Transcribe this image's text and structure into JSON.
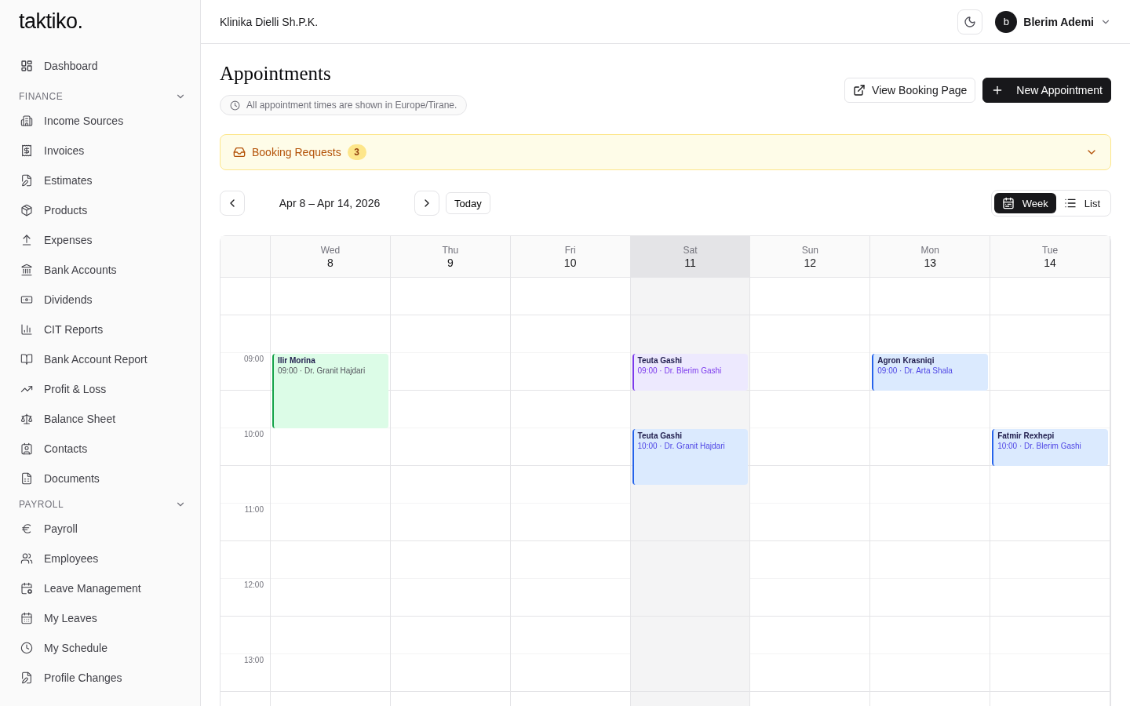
{
  "sidebar": {
    "logo": "taktiko.",
    "top_items": [
      {
        "label": "Dashboard"
      }
    ],
    "sections": [
      {
        "title": "FINANCE",
        "expanded": true,
        "items": [
          {
            "label": "Income Sources"
          },
          {
            "label": "Invoices"
          },
          {
            "label": "Estimates"
          },
          {
            "label": "Products"
          },
          {
            "label": "Expenses"
          },
          {
            "label": "Bank Accounts"
          },
          {
            "label": "Dividends"
          },
          {
            "label": "CIT Reports"
          },
          {
            "label": "Bank Account Report"
          },
          {
            "label": "Profit & Loss"
          },
          {
            "label": "Balance Sheet"
          },
          {
            "label": "Contacts"
          },
          {
            "label": "Documents"
          }
        ]
      },
      {
        "title": "PAYROLL",
        "expanded": true,
        "items": [
          {
            "label": "Payroll"
          },
          {
            "label": "Employees"
          },
          {
            "label": "Leave Management"
          },
          {
            "label": "My Leaves"
          },
          {
            "label": "My Schedule"
          },
          {
            "label": "Profile Changes"
          }
        ]
      }
    ]
  },
  "header": {
    "company": "Klinika Dielli Sh.P.K.",
    "user": {
      "initial": "b",
      "name": "Blerim Ademi"
    }
  },
  "page": {
    "title": "Appointments",
    "timezone_note": "All appointment times are shown in Europe/Tirane.",
    "buttons": [
      {
        "label": "View Booking Page",
        "kind": "secondary"
      },
      {
        "label": "New Appointment",
        "kind": "primary"
      }
    ]
  },
  "booking_requests": {
    "label": "Booking Requests",
    "count": "3",
    "expanded": false
  },
  "toolbar": {
    "range": "Apr 8 – Apr 14, 2026",
    "today": "Today",
    "views": [
      {
        "label": "Week",
        "selected": true
      },
      {
        "label": "List",
        "selected": false
      }
    ]
  },
  "calendar": {
    "hours": [
      "09:00",
      "10:00",
      "11:00",
      "12:00",
      "13:00"
    ],
    "days": [
      {
        "weekday": "Wed",
        "date": "8",
        "selected": false,
        "events": [
          {
            "name": "Ilir Morina",
            "detail": "09:00 · Dr. Granit Hajdari",
            "kind": "hour",
            "color": "#16a34a"
          }
        ]
      },
      {
        "weekday": "Thu",
        "date": "9",
        "selected": false
      },
      {
        "weekday": "Fri",
        "date": "10",
        "selected": false
      },
      {
        "weekday": "Sat",
        "date": "11",
        "selected": true,
        "events": [
          {
            "name": "Teuta Gashi",
            "detail": "09:00 · Dr. Blerim Gashi",
            "kind": "half",
            "color": "#7c3aed"
          },
          {
            "name": "Teuta Gashi",
            "detail": "10:00 · Dr. Granit Hajdari",
            "kind": "three_quarter",
            "color": "#2563eb"
          }
        ]
      },
      {
        "weekday": "Sun",
        "date": "12",
        "selected": false
      },
      {
        "weekday": "Mon",
        "date": "13",
        "selected": false,
        "events": [
          {
            "name": "Agron Krasniqi",
            "detail": "09:00 · Dr. Arta Shala",
            "kind": "half",
            "color": "#2563eb"
          }
        ]
      },
      {
        "weekday": "Tue",
        "date": "14",
        "selected": false,
        "events": [
          {
            "name": "Fatmir Rexhepi",
            "detail": "10:00 · Dr. Blerim Gashi",
            "kind": "half",
            "color": "#2563eb"
          }
        ]
      }
    ]
  }
}
